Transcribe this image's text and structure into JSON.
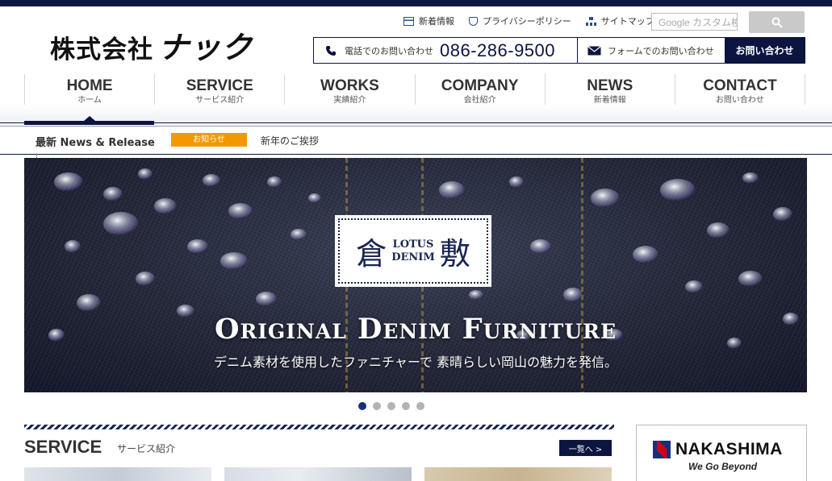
{
  "brand": {
    "logo_main": "株式会社",
    "logo_sub": "ナック"
  },
  "utility": [
    {
      "label": "新着情報",
      "icon": "news-icon"
    },
    {
      "label": "プライバシーポリシー",
      "icon": "privacy-icon"
    },
    {
      "label": "サイトマップ",
      "icon": "sitemap-icon"
    }
  ],
  "search": {
    "placeholder": "Google カスタム検索"
  },
  "contact": {
    "phone_label": "電話でのお問い合わせ",
    "phone_number": "086-286-9500",
    "form_label": "フォームでのお問い合わせ",
    "button_label": "お問い合わせ"
  },
  "nav": [
    {
      "en": "HOME",
      "ja": "ホーム",
      "active": true
    },
    {
      "en": "SERVICE",
      "ja": "サービス紹介"
    },
    {
      "en": "WORKS",
      "ja": "実績紹介"
    },
    {
      "en": "COMPANY",
      "ja": "会社紹介"
    },
    {
      "en": "NEWS",
      "ja": "新着情報"
    },
    {
      "en": "CONTACT",
      "ja": "お問い合わせ"
    }
  ],
  "news_ticker": {
    "label": "最新 News & Release",
    "badge": "お知らせ",
    "text": "新年のご挨拶"
  },
  "hero": {
    "badge_left": "倉",
    "badge_mid_1": "LOTUS",
    "badge_mid_2": "DENIM",
    "badge_right": "敷",
    "title": "Original Denim Furniture",
    "subtitle": "デニム素材を使用したファニチャーで 素晴らしい岡山の魅力を発信。"
  },
  "slider": {
    "dot_count": 5,
    "active_index": 0
  },
  "service": {
    "title": "SERVICE",
    "subtitle": "サービス紹介",
    "more_label": "一覧へ >"
  },
  "sponsor": {
    "name": "NAKASHIMA",
    "tagline": "We Go Beyond"
  },
  "colors": {
    "navy": "#0c1440",
    "badge_orange": "#f39800",
    "dot_active": "#1a2f7a",
    "dot_inactive": "#b3b3b3"
  }
}
